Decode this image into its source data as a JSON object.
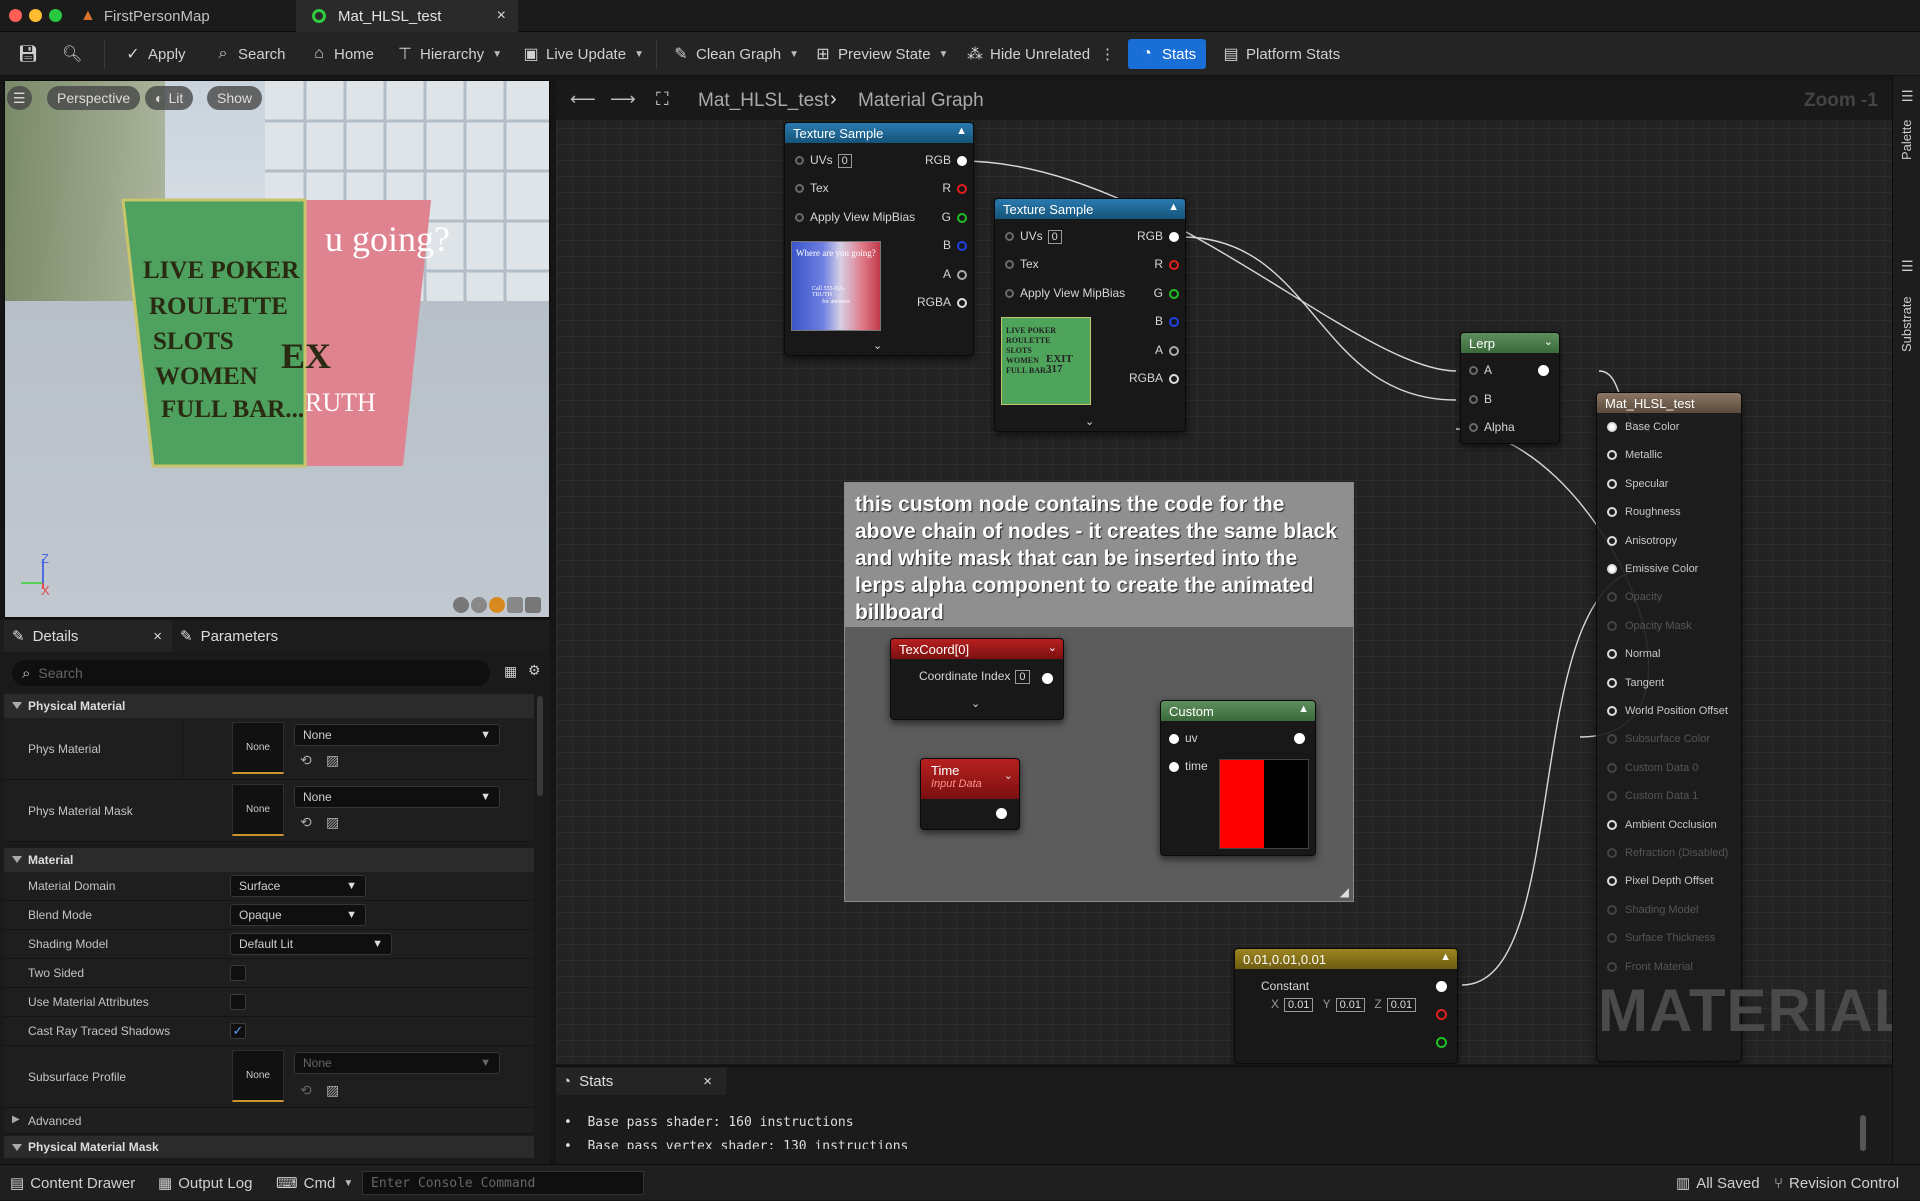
{
  "window": {
    "tabs": [
      {
        "label": "FirstPersonMap",
        "icon": "level-icon"
      },
      {
        "label": "Mat_HLSL_test",
        "icon": "material-icon",
        "close": "×"
      }
    ]
  },
  "toolbar": {
    "apply": "Apply",
    "search": "Search",
    "home": "Home",
    "hierarchy": "Hierarchy",
    "live_update": "Live Update",
    "clean_graph": "Clean Graph",
    "preview_state": "Preview State",
    "hide_unrelated": "Hide Unrelated",
    "stats": "Stats",
    "platform_stats": "Platform Stats"
  },
  "viewport": {
    "perspective": "Perspective",
    "lit": "Lit",
    "show": "Show",
    "axis_z": "Z",
    "axis_x": "X",
    "billboard_left_lines": [
      "LIVE POKER",
      "ROULETTE",
      "SLOTS",
      "WOMEN",
      "FULL BAR..."
    ],
    "billboard_left_exit": "EX",
    "billboard_right_line1": "u going?",
    "billboard_right_line2": "RUTH"
  },
  "details": {
    "tab_details": "Details",
    "tab_parameters": "Parameters",
    "close": "×",
    "search_placeholder": "Search",
    "sections": {
      "physical_material": "Physical Material",
      "material": "Material",
      "advanced": "Advanced",
      "physical_material_mask": "Physical Material Mask"
    },
    "phys_material": {
      "label": "Phys Material",
      "thumb": "None",
      "value": "None"
    },
    "phys_material_mask": {
      "label": "Phys Material Mask",
      "thumb": "None",
      "value": "None"
    },
    "material_domain": {
      "label": "Material Domain",
      "value": "Surface"
    },
    "blend_mode": {
      "label": "Blend Mode",
      "value": "Opaque"
    },
    "shading_model": {
      "label": "Shading Model",
      "value": "Default Lit"
    },
    "two_sided": {
      "label": "Two Sided",
      "checked": false
    },
    "use_material_attributes": {
      "label": "Use Material Attributes",
      "checked": false
    },
    "cast_ray_traced_shadows": {
      "label": "Cast Ray Traced Shadows",
      "checked": true,
      "check_glyph": "✓"
    },
    "subsurface_profile": {
      "label": "Subsurface Profile",
      "thumb": "None",
      "value": "None"
    }
  },
  "graph": {
    "breadcrumb_asset": "Mat_HLSL_test",
    "breadcrumb_sep": "›",
    "breadcrumb_graph": "Material Graph",
    "zoom": "Zoom -1",
    "watermark": "MATERIAL",
    "texture_sample_1": {
      "title": "Texture Sample",
      "in_pins": [
        "UVs",
        "Tex",
        "Apply View MipBias"
      ],
      "uv_index": "0",
      "out_pins": [
        "RGB",
        "R",
        "G",
        "B",
        "A",
        "RGBA"
      ],
      "thumb_text_1": "Where are you going?",
      "thumb_text_2": "Call 555-DA-TRUTH",
      "thumb_text_3": "for answers"
    },
    "texture_sample_2": {
      "title": "Texture Sample",
      "in_pins": [
        "UVs",
        "Tex",
        "Apply View MipBias"
      ],
      "uv_index": "0",
      "out_pins": [
        "RGB",
        "R",
        "G",
        "B",
        "A",
        "RGBA"
      ],
      "thumb_lines": [
        "LIVE POKER",
        "ROULETTE",
        "SLOTS",
        "WOMEN",
        "FULL BAR..."
      ],
      "thumb_exit": "EXIT 317"
    },
    "lerp": {
      "title": "Lerp",
      "pins": [
        "A",
        "B",
        "Alpha"
      ]
    },
    "comment_text": "this custom node contains the code for the above chain of nodes - it creates the same black and white mask that can be inserted into the lerps alpha component to create the animated billboard",
    "texcoord": {
      "title": "TexCoord[0]",
      "pin": "Coordinate Index",
      "index": "0"
    },
    "time": {
      "title": "Time",
      "subtitle": "Input Data"
    },
    "custom": {
      "title": "Custom",
      "pins": [
        "uv",
        "time"
      ]
    },
    "constant": {
      "title": "0.01,0.01,0.01",
      "label": "Constant",
      "x_label": "X",
      "x": "0.01",
      "y_label": "Y",
      "y": "0.01",
      "z_label": "Z",
      "z": "0.01"
    },
    "material_node": {
      "title": "Mat_HLSL_test",
      "pins": [
        {
          "label": "Base Color",
          "enabled": true
        },
        {
          "label": "Metallic",
          "enabled": true
        },
        {
          "label": "Specular",
          "enabled": true
        },
        {
          "label": "Roughness",
          "enabled": true
        },
        {
          "label": "Anisotropy",
          "enabled": true
        },
        {
          "label": "Emissive Color",
          "enabled": true
        },
        {
          "label": "Opacity",
          "enabled": false
        },
        {
          "label": "Opacity Mask",
          "enabled": false
        },
        {
          "label": "Normal",
          "enabled": true
        },
        {
          "label": "Tangent",
          "enabled": true
        },
        {
          "label": "World Position Offset",
          "enabled": true
        },
        {
          "label": "Subsurface Color",
          "enabled": false
        },
        {
          "label": "Custom Data 0",
          "enabled": false
        },
        {
          "label": "Custom Data 1",
          "enabled": false
        },
        {
          "label": "Ambient Occlusion",
          "enabled": true
        },
        {
          "label": "Refraction (Disabled)",
          "enabled": false
        },
        {
          "label": "Pixel Depth Offset",
          "enabled": true
        },
        {
          "label": "Shading Model",
          "enabled": false
        },
        {
          "label": "Surface Thickness",
          "enabled": false
        },
        {
          "label": "Front Material",
          "enabled": false
        }
      ]
    }
  },
  "stats_panel": {
    "tab": "Stats",
    "close": "×",
    "line1": "•  Base pass shader: 160 instructions",
    "line2": "•  Base pass vertex shader: 130 instructions"
  },
  "right_sidebar": {
    "palette": "Palette",
    "substrate": "Substrate"
  },
  "statusbar": {
    "content_drawer": "Content Drawer",
    "output_log": "Output Log",
    "cmd": "Cmd",
    "console_placeholder": "Enter Console Command",
    "all_saved": "All Saved",
    "revision_control": "Revision Control"
  },
  "colors": {
    "accent_blue": "#1a6fd6",
    "texture_header": "#1b5f86",
    "lerp_header": "#4a7a4a",
    "texcoord_header": "#a01818",
    "constant_header": "#8a7418",
    "material_header": "#6b5a4c"
  }
}
